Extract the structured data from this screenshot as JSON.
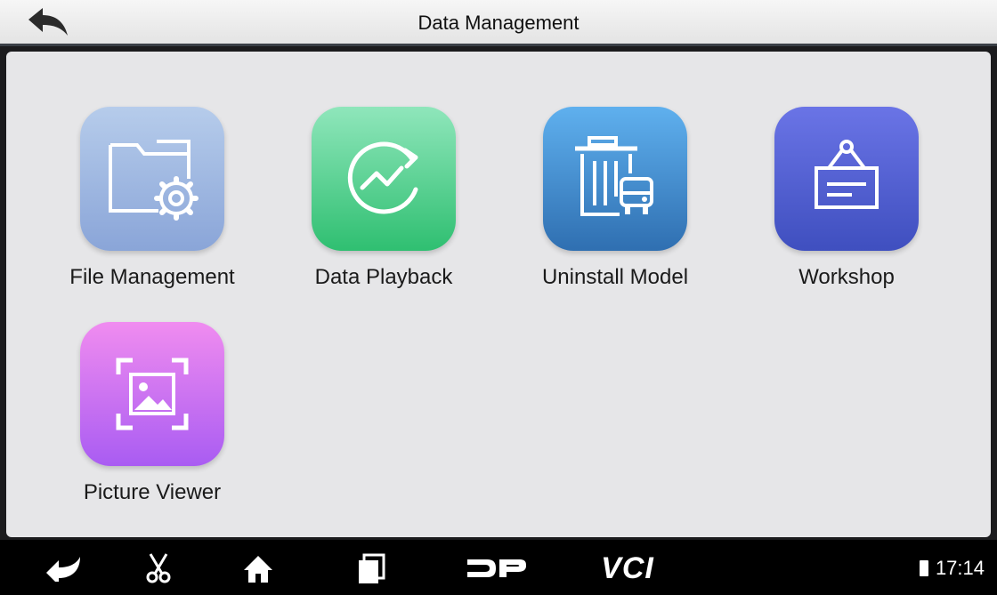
{
  "header": {
    "title": "Data Management"
  },
  "apps": [
    {
      "label": "File Management",
      "icon": "folder-gear-icon"
    },
    {
      "label": "Data Playback",
      "icon": "playback-chart-icon"
    },
    {
      "label": "Uninstall Model",
      "icon": "trash-car-icon"
    },
    {
      "label": "Workshop",
      "icon": "hanging-sign-icon"
    },
    {
      "label": "Picture Viewer",
      "icon": "image-frame-icon"
    }
  ],
  "navbar": {
    "icons": [
      "back-arrow-icon",
      "scissors-icon",
      "home-icon",
      "recent-apps-icon",
      "dp-logo-icon",
      "vci-icon"
    ],
    "vci_label": "VCI",
    "time": "17:14"
  }
}
